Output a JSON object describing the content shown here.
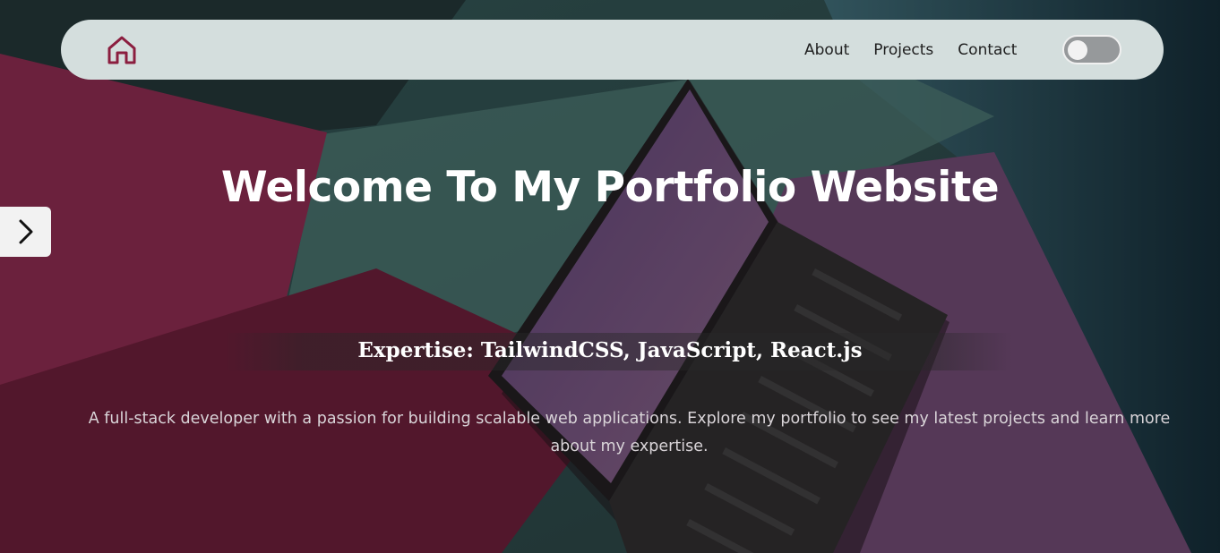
{
  "navbar": {
    "logo_icon": "home-icon",
    "links": [
      "About",
      "Projects",
      "Contact"
    ],
    "theme_toggle_state": "off"
  },
  "side_nav": {
    "arrow_icon": "chevron-right-icon"
  },
  "hero": {
    "title": "Welcome To My Portfolio Website",
    "subtitle": "Expertise: TailwindCSS, JavaScript, React.js",
    "description": "A full-stack developer with a passion for building scalable web applications. Explore my portfolio to see my latest projects and learn more about my expertise."
  },
  "colors": {
    "accent": "#8b1e3f",
    "navbar_bg": "#d4dedd",
    "toggle_bg": "#96999b"
  }
}
